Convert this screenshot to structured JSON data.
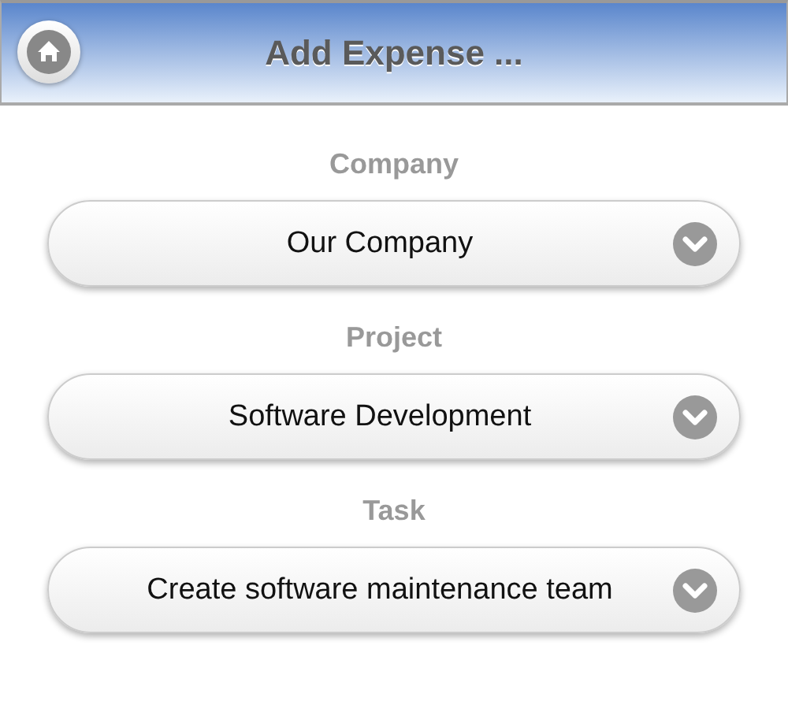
{
  "header": {
    "title": "Add Expense ..."
  },
  "fields": [
    {
      "label": "Company",
      "value": "Our Company"
    },
    {
      "label": "Project",
      "value": "Software Development"
    },
    {
      "label": "Task",
      "value": "Create software maintenance team"
    }
  ]
}
